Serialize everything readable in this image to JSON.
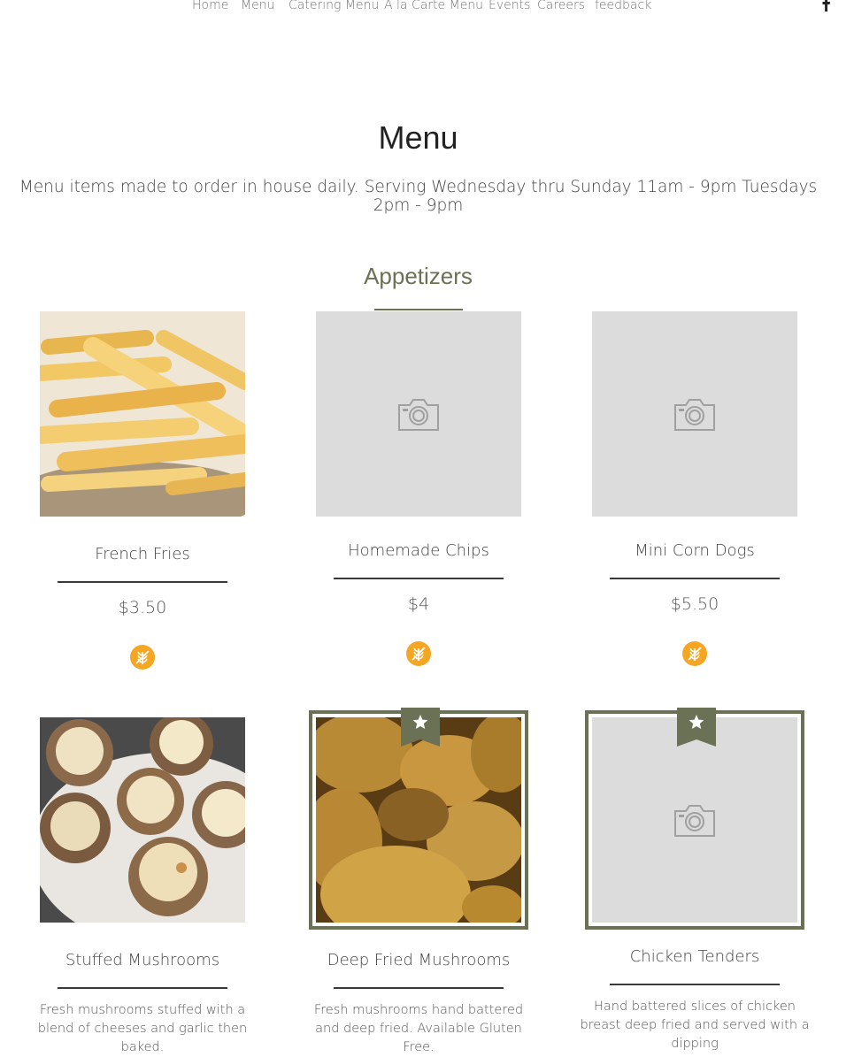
{
  "nav": {
    "items": [
      "Home",
      "Menu",
      "Catering Menu",
      "A la Carte Menu",
      "Events",
      "Careers",
      "feedback"
    ],
    "facebook_icon": "facebook-icon"
  },
  "page": {
    "title": "Menu",
    "subtitle": "Menu items made to order in house daily. Serving Wednesday thru Sunday 11am - 9pm Tuesdays 2pm - 9pm"
  },
  "section": {
    "title": "Appetizers"
  },
  "colors": {
    "accent": "#6b7154",
    "gluten_free_badge": "#f5a623",
    "placeholder": "#dcdcdc"
  },
  "items": [
    {
      "name": "French Fries",
      "price": "$3.50",
      "image": "french-fries-photo",
      "gluten_free_icon": "gluten-free-icon"
    },
    {
      "name": "Homemade Chips",
      "price": "$4",
      "image": "camera-placeholder-icon",
      "gluten_free_icon": "gluten-free-icon"
    },
    {
      "name": "Mini Corn Dogs",
      "price": "$5.50",
      "image": "camera-placeholder-icon",
      "gluten_free_icon": "gluten-free-icon"
    },
    {
      "name": "Stuffed Mushrooms",
      "description": "Fresh mushrooms stuffed with a blend of cheeses and garlic then baked.",
      "image": "stuffed-mushrooms-photo"
    },
    {
      "name": "Deep Fried Mushrooms",
      "description": "Fresh mushrooms hand battered and deep fried. Available Gluten Free.",
      "image": "fried-mushrooms-photo",
      "badge_icon": "star-bookmark-icon"
    },
    {
      "name": "Chicken Tenders",
      "description": "Hand battered slices of chicken breast deep fried and served with a dipping",
      "image": "camera-placeholder-icon",
      "badge_icon": "star-bookmark-icon"
    }
  ]
}
